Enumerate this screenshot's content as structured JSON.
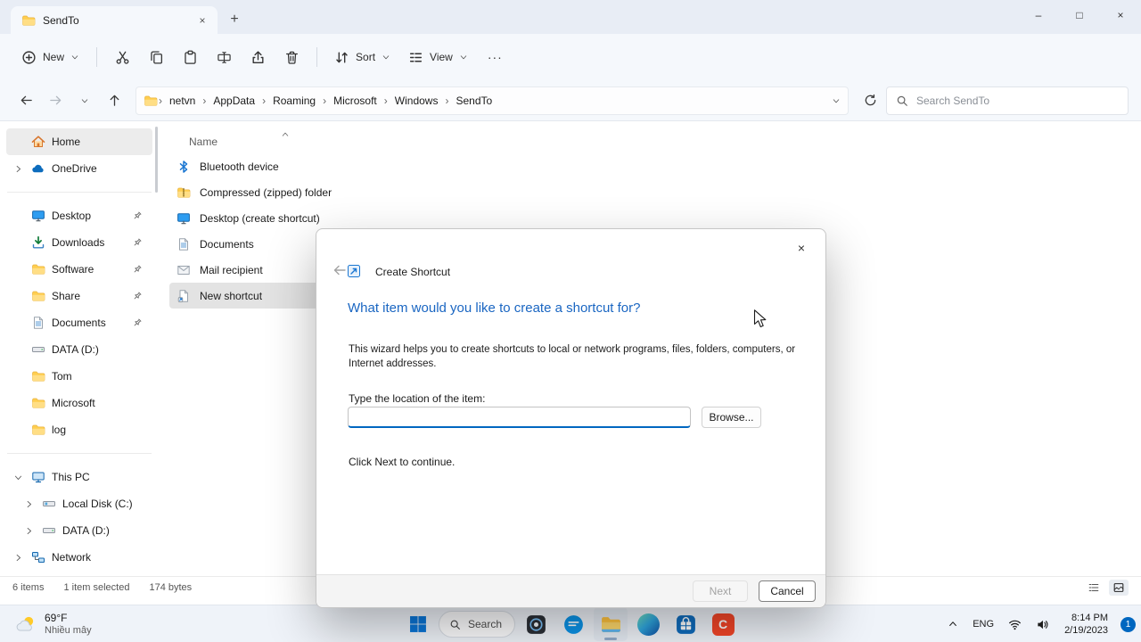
{
  "glyphs": {
    "minimize": "–",
    "maximize": "□",
    "close": "×",
    "tab_close": "×",
    "new_tab": "+",
    "more": "···",
    "crumb_sep": "›"
  },
  "colors": {
    "accent": "#0067c0",
    "dialog_heading_blue": "#1a66c2",
    "chrome": "#f5f8fc",
    "tabstrip": "#e8edf5",
    "selection_gray": "#e3e3e3",
    "taskbar": "#eff3f9"
  },
  "icons": [
    "folder",
    "home",
    "onedrive-cloud",
    "monitor",
    "downloads-arrow",
    "document",
    "drive",
    "drive-os",
    "this-pc",
    "network",
    "bluetooth",
    "zipped-folder",
    "mail",
    "shortcut",
    "wizard-badge",
    "pin",
    "chevron-right",
    "chevron-down",
    "chevron-up",
    "arrow-left",
    "arrow-right",
    "arrow-up",
    "refresh",
    "magnifier",
    "plus-circle",
    "scissors",
    "copy-pages",
    "clipboard",
    "rename-field",
    "share-arrow",
    "trash",
    "sort-arrows",
    "view-lines",
    "windows-logo",
    "edge",
    "store",
    "camera-dark",
    "chat-bubble",
    "wifi",
    "speaker",
    "weather-sun-cloud"
  ],
  "window": {
    "tab_title": "SendTo"
  },
  "toolbar": {
    "new": "New",
    "sort": "Sort",
    "view": "View"
  },
  "address_bar": {
    "breadcrumbs": [
      "netvn",
      "AppData",
      "Roaming",
      "Microsoft",
      "Windows",
      "SendTo"
    ],
    "search_placeholder": "Search SendTo"
  },
  "sidebar": {
    "items": [
      {
        "label": "Home"
      },
      {
        "label": "OneDrive"
      },
      {
        "label": "Desktop"
      },
      {
        "label": "Downloads"
      },
      {
        "label": "Software"
      },
      {
        "label": "Share"
      },
      {
        "label": "Documents"
      },
      {
        "label": "DATA (D:)"
      },
      {
        "label": "Tom"
      },
      {
        "label": "Microsoft"
      },
      {
        "label": "log"
      },
      {
        "label": "This PC"
      },
      {
        "label": "Local Disk (C:)"
      },
      {
        "label": "DATA (D:)"
      },
      {
        "label": "Network"
      }
    ]
  },
  "file_list": {
    "column_header": "Name",
    "items": [
      {
        "label": "Bluetooth device"
      },
      {
        "label": "Compressed (zipped) folder"
      },
      {
        "label": "Desktop (create shortcut)"
      },
      {
        "label": "Documents"
      },
      {
        "label": "Mail recipient"
      },
      {
        "label": "New shortcut"
      }
    ]
  },
  "dialog": {
    "title": "Create Shortcut",
    "heading": "What item would you like to create a shortcut for?",
    "description": "This wizard helps you to create shortcuts to local or network programs, files, folders, computers, or Internet addresses.",
    "input_label": "Type the location of the item:",
    "input_value": "",
    "browse_button": "Browse...",
    "hint": "Click Next to continue.",
    "next_button": "Next",
    "cancel_button": "Cancel"
  },
  "status_bar": {
    "item_count": "6 items",
    "selection": "1 item selected",
    "size": "174 bytes"
  },
  "taskbar": {
    "weather_temp": "69°F",
    "weather_condition": "Nhiều mây",
    "search_label": "Search",
    "app_c_letter": "C",
    "tray": {
      "language": "ENG",
      "time": "8:14 PM",
      "date": "2/19/2023",
      "notification_count": "1"
    }
  }
}
